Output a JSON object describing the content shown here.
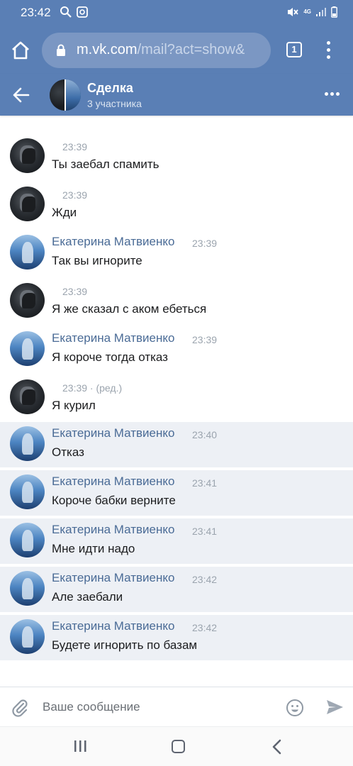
{
  "status_bar": {
    "time": "23:42",
    "network": "4G"
  },
  "browser": {
    "url_host": "m.vk.com",
    "url_path": "/mail?act=show&",
    "tab_count": "1"
  },
  "chat": {
    "title": "Сделка",
    "subtitle": "3 участника"
  },
  "messages": [
    {
      "author": "",
      "time": "23:39",
      "text": "Ты заебал спамить",
      "avatar": "dark-avatar",
      "unread": false
    },
    {
      "author": "",
      "time": "23:39",
      "text": "Жди",
      "avatar": "dark-avatar",
      "unread": false
    },
    {
      "author": "Екатерина Матвиенко",
      "time": "23:39",
      "text": "Так вы игнорите",
      "avatar": "blue-avatar",
      "unread": false
    },
    {
      "author": "",
      "time": "23:39",
      "text": "Я же сказал с аком ебеться",
      "avatar": "dark-avatar",
      "unread": false
    },
    {
      "author": "Екатерина Матвиенко",
      "time": "23:39",
      "text": "Я короче тогда отказ",
      "avatar": "blue-avatar",
      "unread": false
    },
    {
      "author": "",
      "time": "23:39 · (ред.)",
      "text": "Я курил",
      "avatar": "dark-avatar",
      "unread": false
    },
    {
      "author": "Екатерина Матвиенко",
      "time": "23:40",
      "text": "Отказ",
      "avatar": "blue-avatar",
      "unread": true
    },
    {
      "author": "Екатерина Матвиенко",
      "time": "23:41",
      "text": "Короче бабки верните",
      "avatar": "blue-avatar",
      "unread": true
    },
    {
      "author": "Екатерина Матвиенко",
      "time": "23:41",
      "text": "Мне идти надо",
      "avatar": "blue-avatar",
      "unread": true
    },
    {
      "author": "Екатерина Матвиенко",
      "time": "23:42",
      "text": "Але заебали",
      "avatar": "blue-avatar",
      "unread": true
    },
    {
      "author": "Екатерина Матвиенко",
      "time": "23:42",
      "text": "Будете игнорить по базам",
      "avatar": "blue-avatar",
      "unread": true
    }
  ],
  "composer": {
    "placeholder": "Ваше сообщение"
  },
  "colors": {
    "header_bg": "#5a7fb5",
    "author_link": "#4a6b96",
    "unread_bg": "#edf0f5"
  },
  "icons": {
    "attach": "paperclip-icon",
    "emoji": "smiley-icon",
    "send": "send-arrow-icon"
  }
}
